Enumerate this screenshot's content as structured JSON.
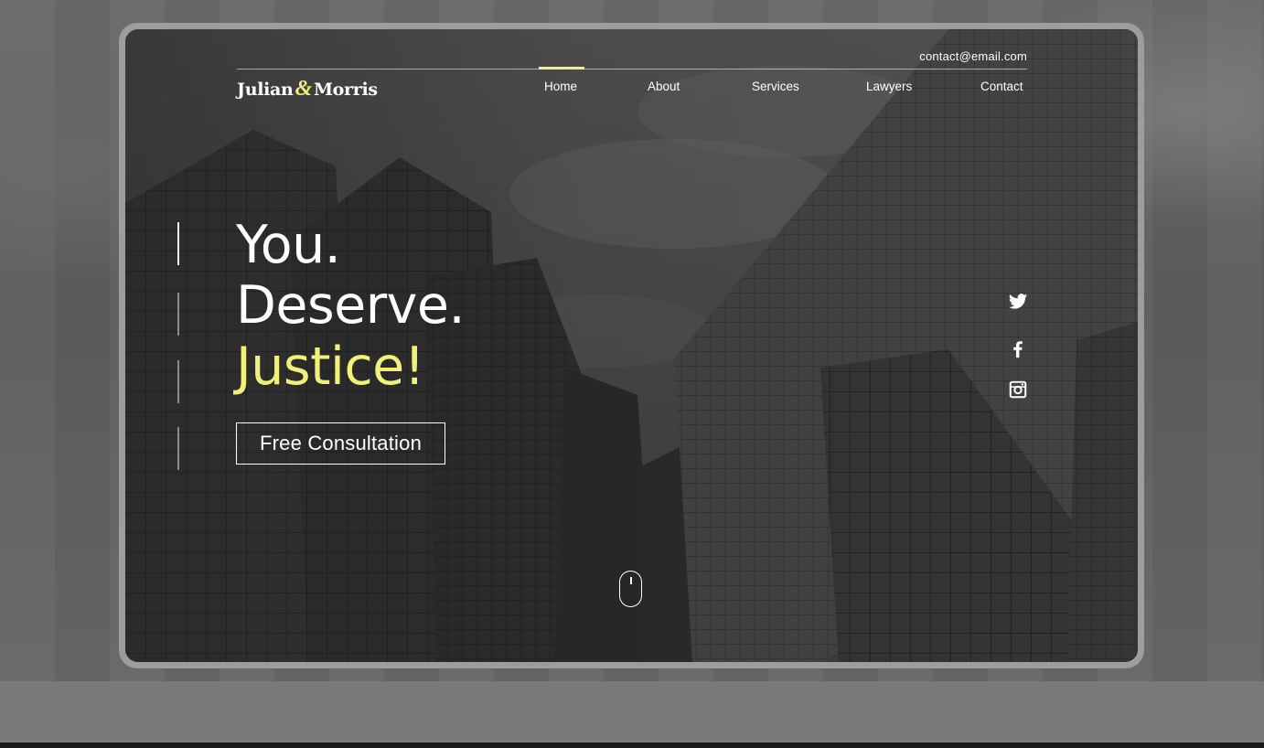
{
  "header": {
    "email": "contact@email.com",
    "logo": {
      "part1": "Julian",
      "amp": "&",
      "part2": "Morris"
    }
  },
  "nav": {
    "items": [
      {
        "label": "Home",
        "active": true
      },
      {
        "label": "About",
        "active": false
      },
      {
        "label": "Services",
        "active": false
      },
      {
        "label": "Lawyers",
        "active": false
      },
      {
        "label": "Contact",
        "active": false
      }
    ]
  },
  "hero": {
    "line1": "You.",
    "line2": "Deserve.",
    "line3": "Justice!",
    "cta_label": "Free Consultation",
    "slides_count": 4,
    "active_slide": 1
  },
  "social": {
    "icons": [
      "twitter-icon",
      "facebook-icon",
      "instagram-icon"
    ]
  },
  "colors": {
    "accent": "#f3f07a",
    "text": "#ffffff",
    "frame": "#9d9d9d",
    "screen_bg": "#3c3c3c"
  }
}
